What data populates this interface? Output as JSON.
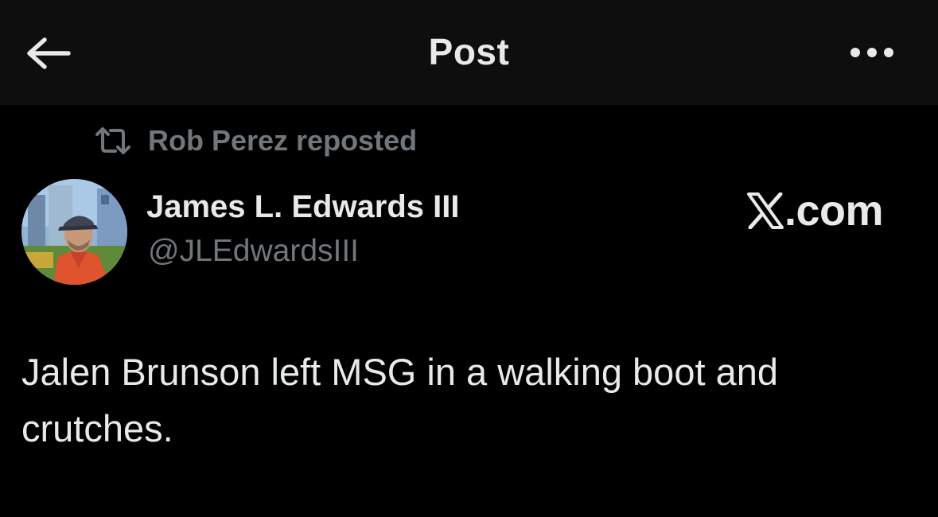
{
  "header": {
    "title": "Post",
    "back_icon": "arrow-left-icon",
    "more_icon": "more-horizontal-icon"
  },
  "repost": {
    "icon": "repost-icon",
    "text": "Rob Perez reposted"
  },
  "author": {
    "display_name": "James L. Edwards III",
    "handle": "@JLEdwardsIII"
  },
  "watermark": {
    "text": ".com"
  },
  "post": {
    "text": "Jalen Brunson left MSG in a walking boot and crutches."
  },
  "colors": {
    "background": "#000000",
    "header_background": "#0e0e0e",
    "primary_text": "#e7e9ea",
    "secondary_text": "#71767b"
  }
}
